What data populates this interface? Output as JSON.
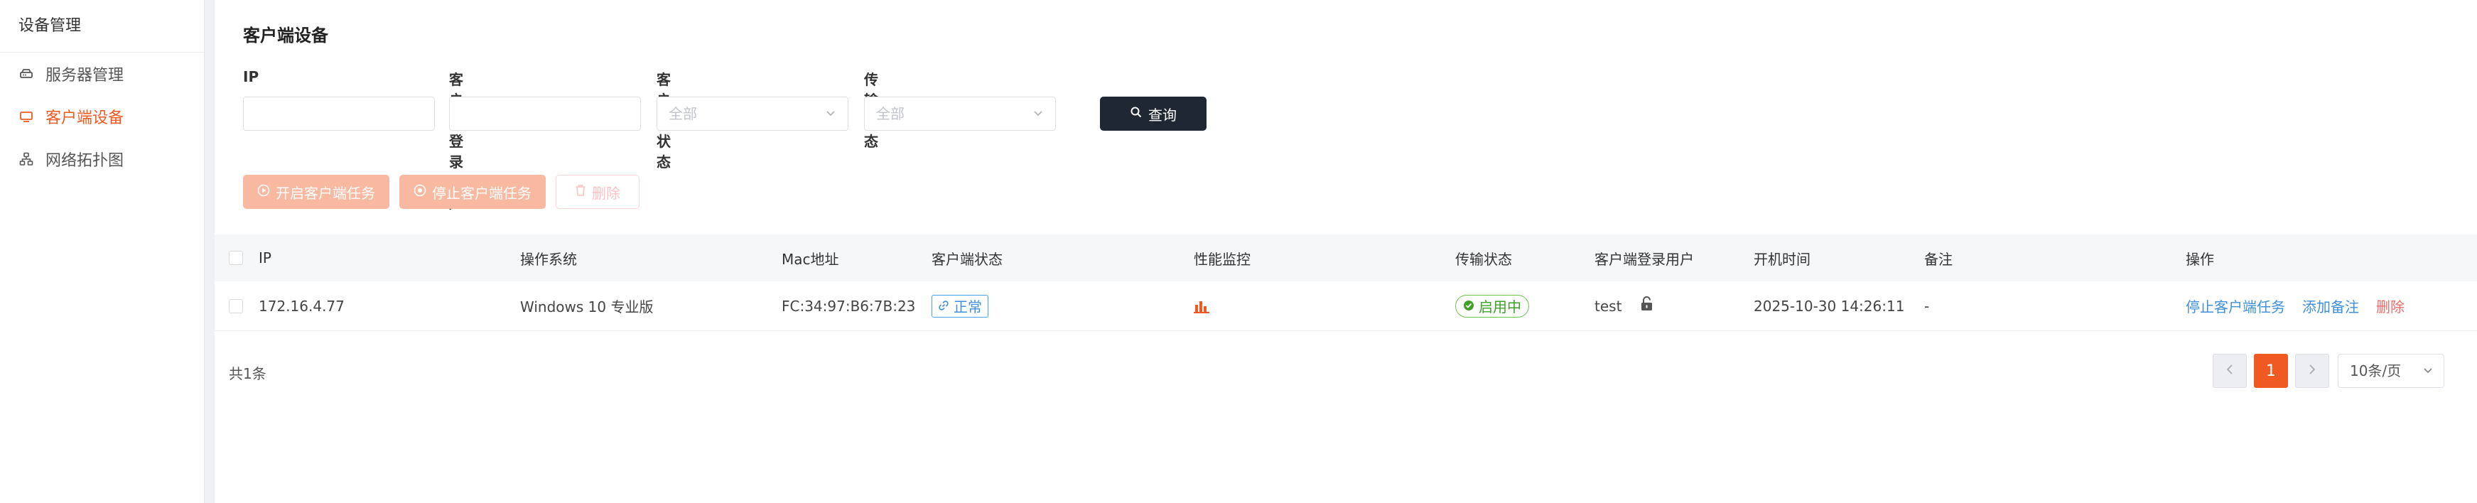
{
  "sidebar": {
    "header": "设备管理",
    "items": [
      {
        "label": "服务器管理",
        "icon": "server-icon",
        "active": false
      },
      {
        "label": "客户端设备",
        "icon": "monitor-icon",
        "active": true
      },
      {
        "label": "网络拓扑图",
        "icon": "topology-icon",
        "active": false
      }
    ]
  },
  "page": {
    "title": "客户端设备"
  },
  "filters": {
    "ip_label": "IP",
    "user_label": "客户端登录用户",
    "client_status_label": "客户端状态",
    "client_status_value": "全部",
    "transfer_status_label": "传输状态",
    "transfer_status_value": "全部",
    "query_label": "查询"
  },
  "actions": {
    "start_label": "开启客户端任务",
    "stop_label": "停止客户端任务",
    "delete_label": "删除"
  },
  "table": {
    "headers": {
      "ip": "IP",
      "os": "操作系统",
      "mac": "Mac地址",
      "client_status": "客户端状态",
      "perf": "性能监控",
      "transfer": "传输状态",
      "user": "客户端登录用户",
      "boot_time": "开机时间",
      "remark": "备注",
      "ops": "操作"
    },
    "rows": [
      {
        "ip": "172.16.4.77",
        "os": "Windows 10 专业版",
        "mac": "FC:34:97:B6:7B:23",
        "client_status": "正常",
        "transfer": "启用中",
        "user": "test",
        "boot_time": "2025-10-30 14:26:11",
        "remark": "-",
        "op_stop": "停止客户端任务",
        "op_remark": "添加备注",
        "op_delete": "删除"
      }
    ]
  },
  "pagination": {
    "total": "共1条",
    "current_page": "1",
    "page_size": "10条/页"
  },
  "colors": {
    "accent": "#f05a22",
    "link": "#3f8fdd",
    "success": "#3fa12a",
    "danger": "#f06a6a",
    "query_button": "#1f2733"
  }
}
